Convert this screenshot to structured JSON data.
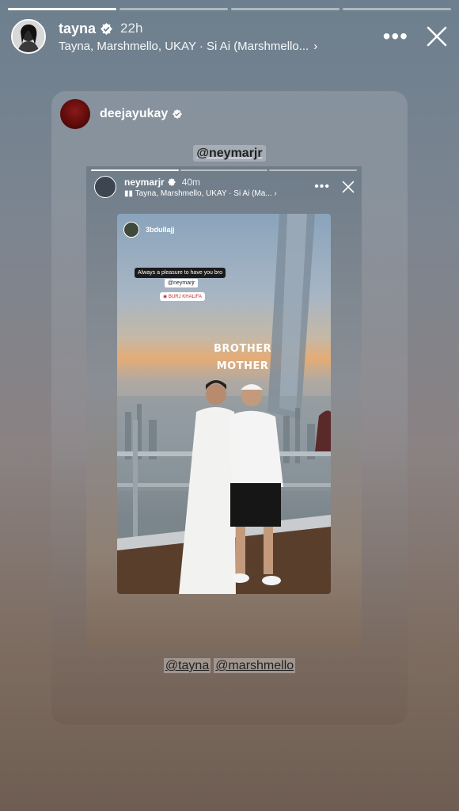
{
  "story": {
    "progress_segments": 4,
    "progress_done": 1,
    "username": "tayna",
    "time": "22h",
    "music_line": "Tayna, Marshmello, UKAY · Si Ai (Marshmello..."
  },
  "reshare": {
    "username": "deejayukay",
    "mention_top": "@neymarjr",
    "mention_bottom_1": "@tayna",
    "mention_bottom_2": "@marshmello"
  },
  "inner_story": {
    "username": "neymarjr",
    "time": "40m",
    "music_line": "Tayna, Marshmello, UKAY · Si Ai (Ma...",
    "photo_user": "3bdullajj",
    "sticker_text": "Always a pleasure to have you bro",
    "sticker_mention": "@neymarjr",
    "location": "BURJ KHALIFA",
    "overlay_line1": "BROTHER",
    "overlay_line2": "MOTHER"
  },
  "colors": {
    "accent_sunset": "#e4ac76",
    "verified_blue": "#3897f0"
  },
  "icons": {
    "more": "more-options-icon",
    "close": "close-icon",
    "verified": "verified-badge-icon",
    "music": "music-icon"
  }
}
